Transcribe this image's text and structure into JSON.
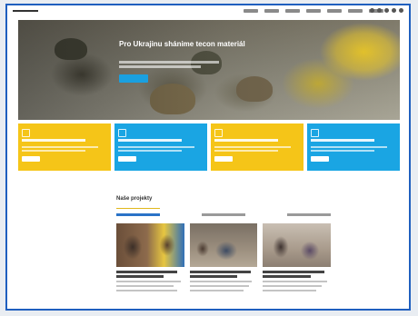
{
  "nav": {
    "logo": "",
    "items": [
      "",
      "",
      "",
      "",
      "",
      "",
      ""
    ],
    "social_icons": [
      "facebook-icon",
      "instagram-icon",
      "twitter-icon",
      "linkedin-icon",
      "youtube-icon"
    ]
  },
  "hero": {
    "title": "Pro Ukrajinu shánime tecon materiál",
    "button_label": ""
  },
  "cards": [
    {
      "color": "#f5c518",
      "icon": "box-icon",
      "title": "",
      "button_label": ""
    },
    {
      "color": "#1aa5e3",
      "icon": "box-icon",
      "title": "",
      "button_label": ""
    },
    {
      "color": "#f5c518",
      "icon": "box-icon",
      "title": "",
      "button_label": ""
    },
    {
      "color": "#1aa5e3",
      "icon": "box-icon",
      "title": "",
      "button_label": ""
    }
  ],
  "projects_section": {
    "title": "Naše projekty",
    "tabs": [
      "",
      "",
      ""
    ],
    "projects": [
      {
        "title": ""
      },
      {
        "title": ""
      },
      {
        "title": ""
      }
    ]
  },
  "colors": {
    "accent_blue": "#1aa5e3",
    "accent_yellow": "#f5c518",
    "frame_border": "#1f5fbf"
  }
}
